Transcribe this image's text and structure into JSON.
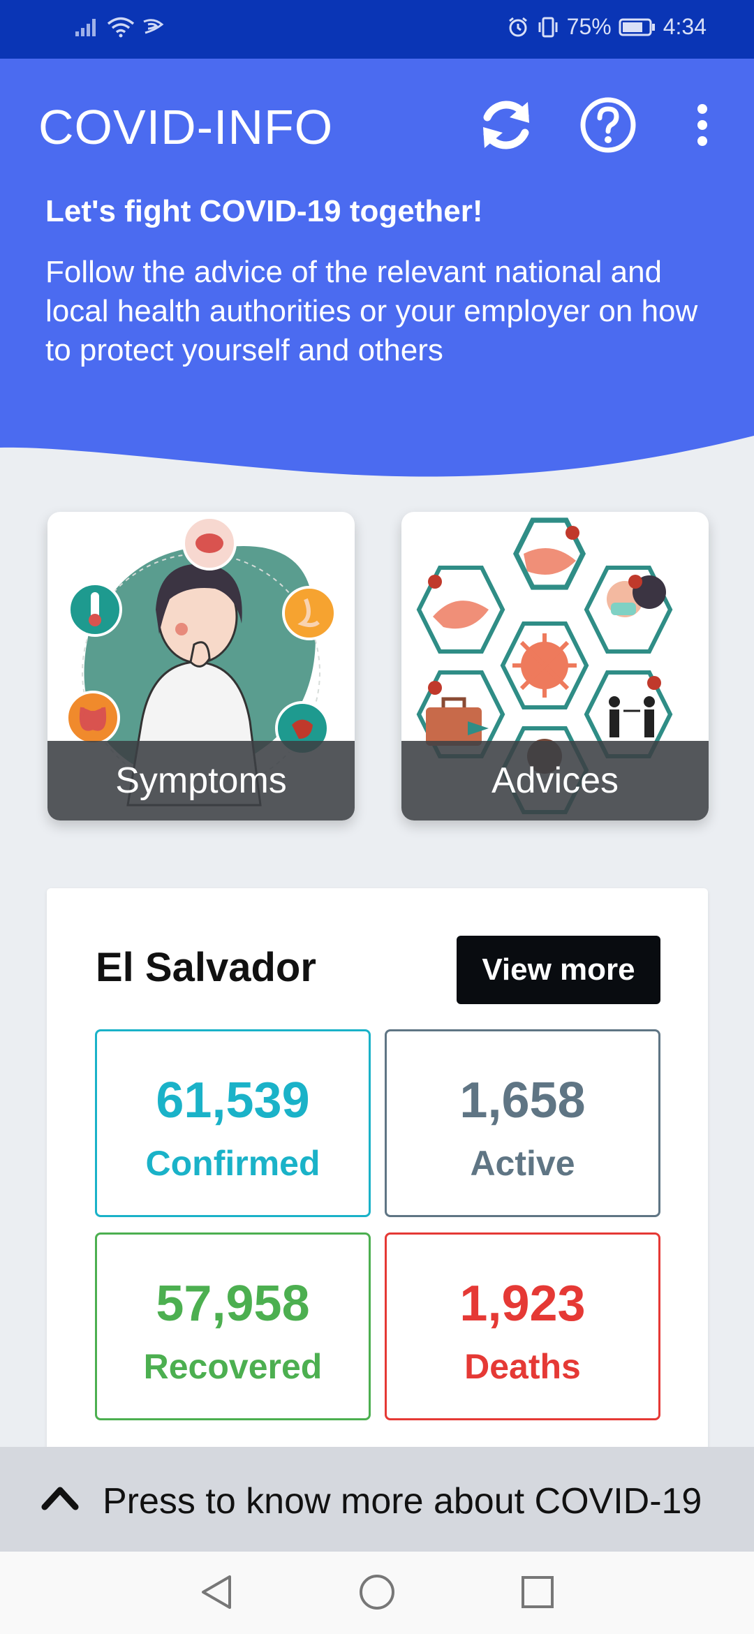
{
  "status_bar": {
    "battery": "75%",
    "time": "4:34",
    "icons": [
      "signal-icon",
      "wifi-icon",
      "nfc-icon",
      "alarm-icon",
      "vibrate-icon",
      "battery-icon"
    ]
  },
  "header": {
    "title": "COVID-INFO",
    "tagline": "Let's fight COVID-19 together!",
    "intro": "Follow the advice of the relevant national and local health authorities or your employer on how to protect yourself and others",
    "icons": [
      "refresh-icon",
      "help-icon",
      "more-vert-icon"
    ]
  },
  "cards": [
    {
      "label": "Symptoms"
    },
    {
      "label": "Advices"
    }
  ],
  "stats": {
    "country": "El Salvador",
    "view_more": "View more",
    "confirmed": {
      "value": "61,539",
      "label": "Confirmed",
      "color": "#1ab2c8"
    },
    "active": {
      "value": "1,658",
      "label": "Active",
      "color": "#5f7584"
    },
    "recovered": {
      "value": "57,958",
      "label": "Recovered",
      "color": "#4caf50"
    },
    "deaths": {
      "value": "1,923",
      "label": "Deaths",
      "color": "#e53935"
    }
  },
  "bottom_sheet": {
    "text": "Press to know more about COVID-19"
  },
  "colors": {
    "primary": "#4b6bf0",
    "status_bar": "#0a35b5",
    "background": "#ebeef2"
  }
}
